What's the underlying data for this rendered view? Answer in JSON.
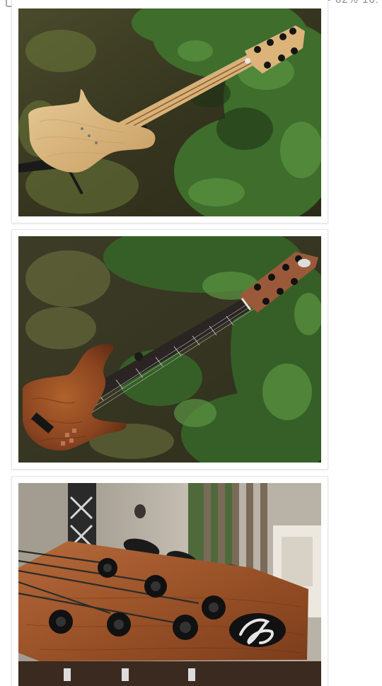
{
  "status_bar": {
    "right_text": "•• 62% 10:"
  },
  "feed": {
    "photos": [
      {
        "subject": "bass-natural-ash"
      },
      {
        "subject": "bass-bubinga"
      },
      {
        "subject": "headstock-closeup"
      }
    ]
  },
  "colors": {
    "grass_dark": "#2b3a1c",
    "leaf_green": "#3f7a2e",
    "ash_wood": "#d9b784",
    "bubinga": "#8a4420",
    "fretboard": "#2a2422",
    "fence_wood": "#b9b2a6"
  }
}
